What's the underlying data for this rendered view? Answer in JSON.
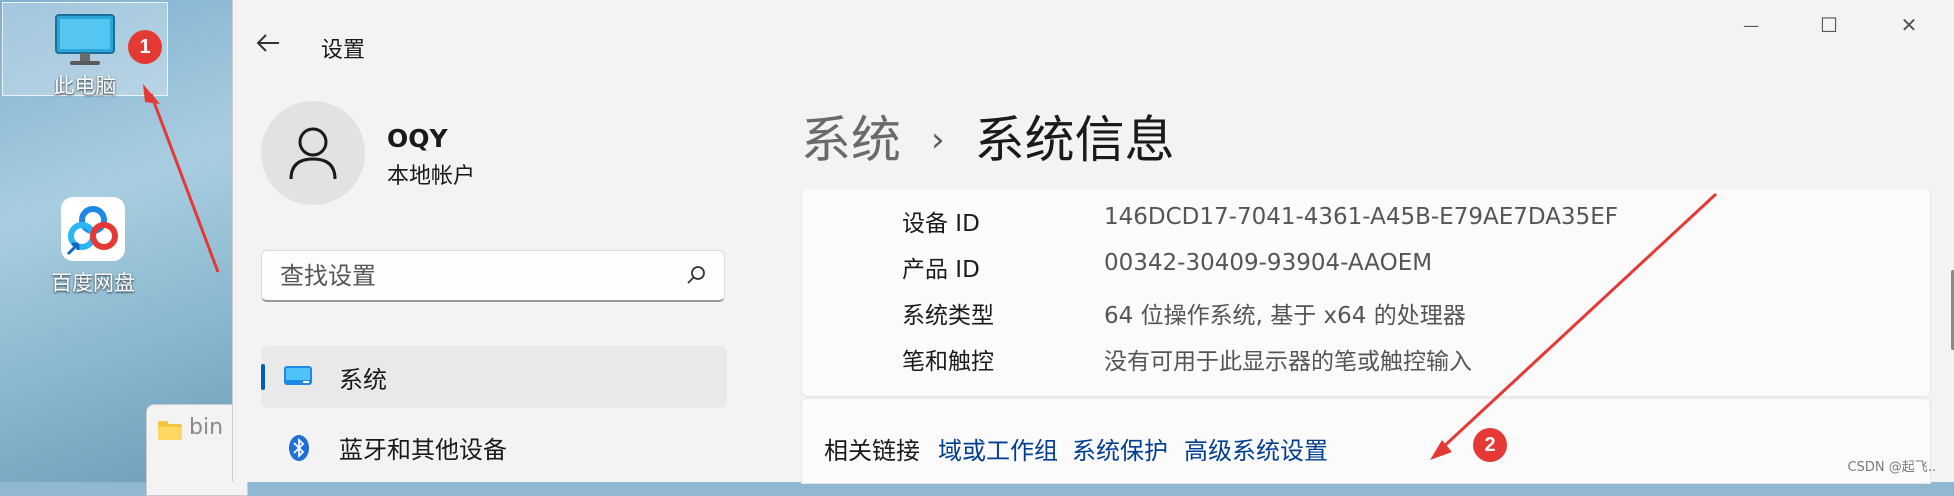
{
  "desktop": {
    "icons": [
      {
        "label": "此电脑"
      },
      {
        "label": "百度网盘"
      }
    ],
    "badges": [
      "1",
      "2"
    ]
  },
  "explorer": {
    "label": "bin"
  },
  "window": {
    "app_title": "设置",
    "controls": {
      "minimize": "—",
      "maximize": "☐",
      "close": "✕"
    }
  },
  "account": {
    "name": "OQY",
    "type": "本地帐户"
  },
  "search": {
    "placeholder": "查找设置"
  },
  "nav": [
    {
      "label": "系统",
      "active": true
    },
    {
      "label": "蓝牙和其他设备",
      "active": false
    }
  ],
  "breadcrumb": {
    "parent": "系统",
    "separator": "›",
    "current": "系统信息"
  },
  "specs": [
    {
      "key": "设备 ID",
      "value": "146DCD17-7041-4361-A45B-E79AE7DA35EF"
    },
    {
      "key": "产品 ID",
      "value": "00342-30409-93904-AAOEM"
    },
    {
      "key": "系统类型",
      "value": "64 位操作系统, 基于 x64 的处理器"
    },
    {
      "key": "笔和触控",
      "value": "没有可用于此显示器的笔或触控输入"
    }
  ],
  "related": {
    "label": "相关链接",
    "links": [
      "域或工作组",
      "系统保护",
      "高级系统设置"
    ]
  },
  "watermark": "CSDN @起飞..",
  "colors": {
    "accent": "#005fb8",
    "link": "#003e92",
    "annotation": "#e53935"
  }
}
